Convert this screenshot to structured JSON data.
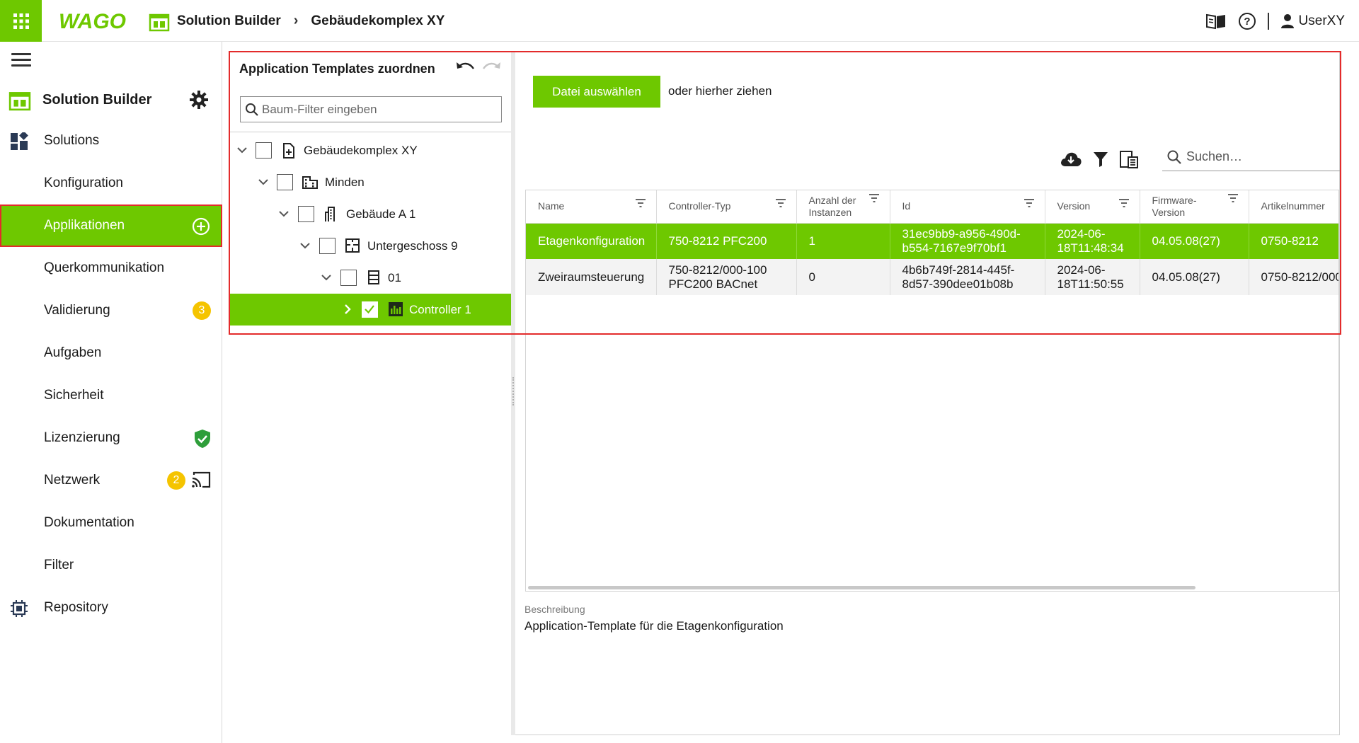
{
  "header": {
    "logo_text": "WAGO",
    "breadcrumb": [
      "Solution Builder",
      "Gebäudekomplex XY"
    ],
    "user": "UserXY"
  },
  "sidebar": {
    "title": "Solution Builder",
    "items": [
      {
        "label": "Solutions",
        "icon": "dashboard-icon"
      },
      {
        "label": "Konfiguration"
      },
      {
        "label": "Applikationen",
        "active": true,
        "trail_icon": "add-circle-icon"
      },
      {
        "label": "Querkommunikation"
      },
      {
        "label": "Validierung",
        "badge": "3"
      },
      {
        "label": "Aufgaben"
      },
      {
        "label": "Sicherheit"
      },
      {
        "label": "Lizenzierung",
        "trail_icon": "shield-check-icon"
      },
      {
        "label": "Netzwerk",
        "badge": "2",
        "trail_icon": "cast-icon"
      },
      {
        "label": "Dokumentation"
      },
      {
        "label": "Filter"
      },
      {
        "label": "Repository",
        "icon": "chip-icon"
      }
    ]
  },
  "tree_panel": {
    "title": "Application Templates zuordnen",
    "filter_placeholder": "Baum-Filter eingeben",
    "nodes": [
      {
        "label": "Gebäudekomplex XY",
        "level": 0,
        "icon": "file-icon"
      },
      {
        "label": "Minden",
        "level": 1,
        "icon": "city-icon"
      },
      {
        "label": "Gebäude A 1",
        "level": 2,
        "icon": "building-icon"
      },
      {
        "label": "Untergeschoss 9",
        "level": 3,
        "icon": "floorplan-icon"
      },
      {
        "label": "01",
        "level": 4,
        "icon": "floor-icon"
      },
      {
        "label": "Controller 1",
        "level": 5,
        "icon": "controller-icon",
        "selected": true,
        "checked": true
      }
    ]
  },
  "upload": {
    "button": "Datei auswählen",
    "hint": "oder hierher ziehen"
  },
  "search": {
    "placeholder": "Suchen…"
  },
  "table": {
    "columns": [
      "Name",
      "Controller-Typ",
      "Anzahl der Instanzen",
      "Id",
      "Version",
      "Firmware-Version",
      "Artikelnummer"
    ],
    "rows": [
      {
        "name": "Etagenkonfiguration",
        "controller": [
          "750-8212 PFC200",
          ""
        ],
        "instances": "1",
        "id": [
          "31ec9bb9-a956-490d-",
          "b554-7167e9f70bf1"
        ],
        "version": [
          "2024-06-",
          "18T11:48:34"
        ],
        "firmware": "04.05.08(27)",
        "article": "0750-8212",
        "selected": true
      },
      {
        "name": "Zweiraumsteuerung",
        "controller": [
          "750-8212/000-100",
          "PFC200 BACnet"
        ],
        "instances": "0",
        "id": [
          "4b6b749f-2814-445f-",
          "8d57-390dee01b08b"
        ],
        "version": [
          "2024-06-",
          "18T11:50:55"
        ],
        "firmware": "04.05.08(27)",
        "article": "0750-8212/000",
        "selected": false
      }
    ]
  },
  "description": {
    "label": "Beschreibung",
    "text": "Application-Template für die Etagenkonfiguration"
  },
  "colors": {
    "accent": "#6ec800",
    "highlight_border": "#e32b2b",
    "badge": "#f5c400"
  }
}
